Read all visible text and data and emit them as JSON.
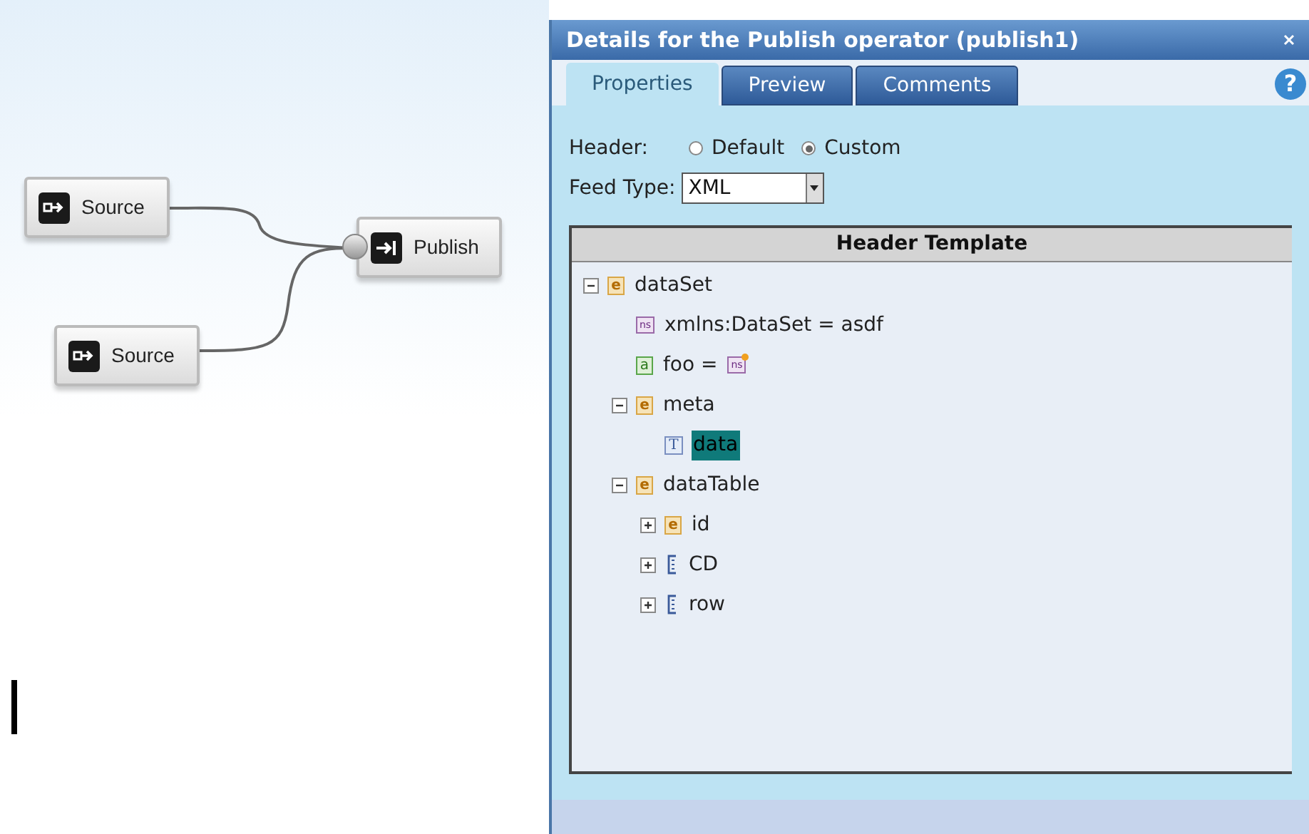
{
  "canvas": {
    "nodes": [
      {
        "kind": "source",
        "label": "Source"
      },
      {
        "kind": "source",
        "label": "Source"
      },
      {
        "kind": "publish",
        "label": "Publish"
      }
    ]
  },
  "dialog": {
    "title": "Details for the Publish operator (publish1)",
    "tabs": [
      {
        "label": "Properties",
        "selected": true
      },
      {
        "label": "Preview",
        "selected": false
      },
      {
        "label": "Comments",
        "selected": false
      }
    ],
    "help": "?",
    "header": {
      "label": "Header:",
      "options": [
        {
          "label": "Default",
          "selected": false
        },
        {
          "label": "Custom",
          "selected": true
        }
      ]
    },
    "feed_type": {
      "label": "Feed Type:",
      "value": "XML"
    },
    "template": {
      "title": "Header Template",
      "tree": [
        {
          "kind": "element",
          "badge": "e",
          "label": "dataSet",
          "expanded": true,
          "selected": false,
          "children": [
            {
              "kind": "namespace",
              "badge": "ns",
              "label": "xmlns:DataSet = asdf",
              "selected": false
            },
            {
              "kind": "attribute",
              "badge": "a",
              "label": "foo =",
              "value_badge": "ns",
              "selected": false
            },
            {
              "kind": "element",
              "badge": "e",
              "label": "meta",
              "expanded": true,
              "selected": false,
              "children": [
                {
                  "kind": "text",
                  "badge": "T",
                  "label": "data",
                  "selected": true
                }
              ]
            },
            {
              "kind": "element",
              "badge": "e",
              "label": "dataTable",
              "expanded": true,
              "selected": false,
              "children": [
                {
                  "kind": "element",
                  "badge": "e",
                  "label": "id",
                  "expanded": false,
                  "selected": false
                },
                {
                  "kind": "group",
                  "label": "CD",
                  "expanded": false,
                  "selected": false
                },
                {
                  "kind": "group",
                  "label": "row",
                  "expanded": false,
                  "selected": false
                }
              ]
            }
          ]
        }
      ]
    }
  }
}
